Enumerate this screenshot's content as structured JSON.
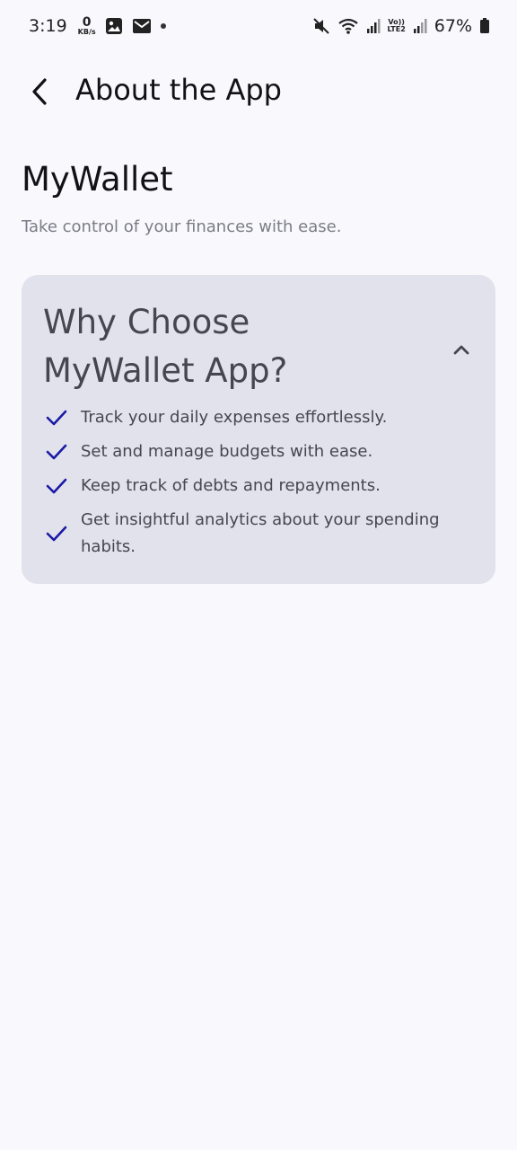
{
  "status_bar": {
    "time": "3:19",
    "net_speed_value": "0",
    "net_speed_unit": "KB/s",
    "battery": "67%",
    "network_label_top": "Vo))",
    "network_label_bottom": "LTE2",
    "icons": [
      "gallery-icon",
      "mail-icon",
      "dot-icon",
      "mute-icon",
      "wifi-icon",
      "signal-icon",
      "signal-icon",
      "battery-icon"
    ]
  },
  "app_bar": {
    "title": "About the App",
    "back_icon": "chevron-left-icon"
  },
  "app": {
    "name": "MyWallet",
    "tagline": "Take control of your finances with ease."
  },
  "card": {
    "title": "Why Choose MyWallet App?",
    "toggle_icon": "chevron-up-icon",
    "features": [
      "Track your daily expenses effortlessly.",
      "Set and manage budgets with ease.",
      "Keep track of debts and repayments.",
      "Get insightful analytics about your spending habits."
    ]
  },
  "colors": {
    "background": "#f8f8fd",
    "card": "#e2e2ec",
    "check": "#1a1aa6",
    "muted_text": "#7c7c86"
  }
}
